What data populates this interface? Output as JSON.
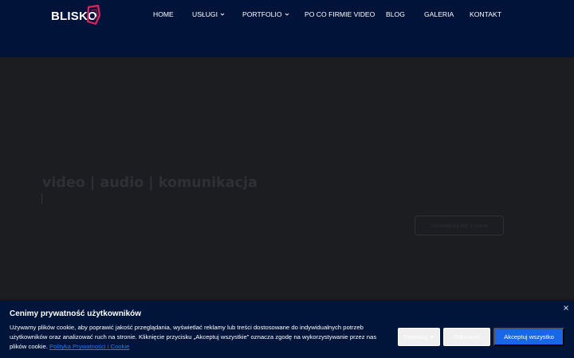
{
  "header": {
    "logo_text": "BLISKO",
    "nav": [
      {
        "label": "HOME",
        "has_dropdown": false
      },
      {
        "label": "USŁUGI",
        "has_dropdown": true
      },
      {
        "label": "PORTFOLIO",
        "has_dropdown": true
      },
      {
        "label": "PO CO FIRMIE VIDEO",
        "has_dropdown": false
      },
      {
        "label": "BLOG",
        "has_dropdown": false
      },
      {
        "label": "GALERIA",
        "has_dropdown": false
      },
      {
        "label": "KONTAKT",
        "has_dropdown": false
      }
    ]
  },
  "hero": {
    "title": "video | audio | komunikacja",
    "button_label": "Skontaktuj się z nami"
  },
  "cookie_banner": {
    "title": "Cenimy prywatność użytkowników",
    "text": "Używamy plików cookie, aby poprawić jakość przeglądania, wyświetlać reklamy lub treści dostosowane do indywidualnych potrzeb użytkowników oraz analizować ruch na stronie. Kliknięcie przycisku „Akceptuj wszystkie” oznacza zgodę na wykorzystywanie przez nas plików cookie.",
    "link_text": "Polityka Prywatności i Cookie",
    "customize_label": "Dostosuj",
    "reject_label": "Odrzucać",
    "accept_label": "Akceptuj wszystko"
  },
  "colors": {
    "header_bg": "#02133a",
    "hero_bg": "#1c1d21",
    "banner_bg": "#01153b",
    "accent": "#1767e6",
    "logo_accent": "#e0245e",
    "link": "#1d78ff"
  },
  "icons": {
    "logo_mark": "logo-mark-icon",
    "dropdown": "chevron-down-icon",
    "close": "close-icon",
    "caret": "caret-down-icon"
  }
}
